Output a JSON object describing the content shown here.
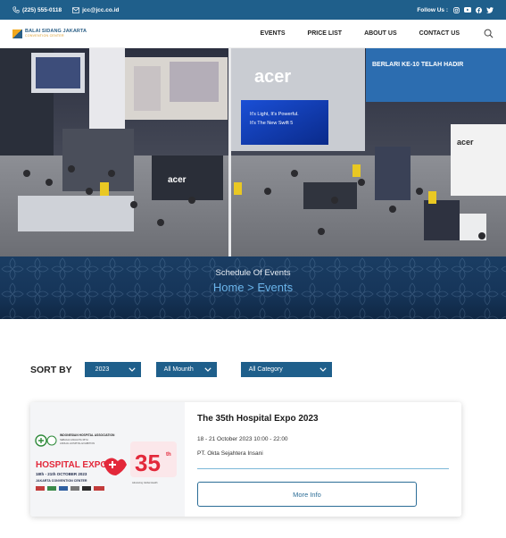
{
  "topbar": {
    "phone": "(225) 555-0118",
    "email": "jcc@jcc.co.id",
    "follow_label": "Follow Us :",
    "social_icons": [
      "instagram-icon",
      "youtube-icon",
      "facebook-icon",
      "twitter-icon"
    ]
  },
  "nav": {
    "logo_line1": "BALAI SIDANG JAKARTA",
    "logo_line2": "CONVENTION CENTER",
    "items": [
      "EVENTS",
      "PRICE LIST",
      "ABOUT US",
      "CONTACT US"
    ]
  },
  "hero": {
    "description": "Exhibition hall with acer booth and visitors",
    "sign_main": "acer",
    "screen_text": "It's Light, It's Powerful. It's The New Swift 5",
    "banner_text": "BERLARI KE-10 TELAH HADIR"
  },
  "banner": {
    "title": "Schedule Of Events",
    "crumb_home": "Home",
    "crumb_sep": ">",
    "crumb_current": "Events"
  },
  "sort": {
    "label": "SORT BY",
    "year": "2023",
    "month": "All Mounth",
    "category": "All Category"
  },
  "event": {
    "title": "The 35th Hospital Expo 2023",
    "date": "18 - 21 October 2023 10:00 - 22:00",
    "organizer": "PT. Okta Sejahtera Insani",
    "button": "More Info",
    "poster": {
      "org": "INDONESIAN HOSPITAL ASSOCIATION",
      "expo": "HOSPITAL EXPO",
      "dates": "18th - 21th OCTOBER 2023",
      "venue": "JAKARTA CONVENTION CENTER",
      "number": "35"
    }
  },
  "colors": {
    "primary": "#1f5f8b",
    "accent": "#6ab4ea",
    "poster_red": "#e3283a"
  }
}
